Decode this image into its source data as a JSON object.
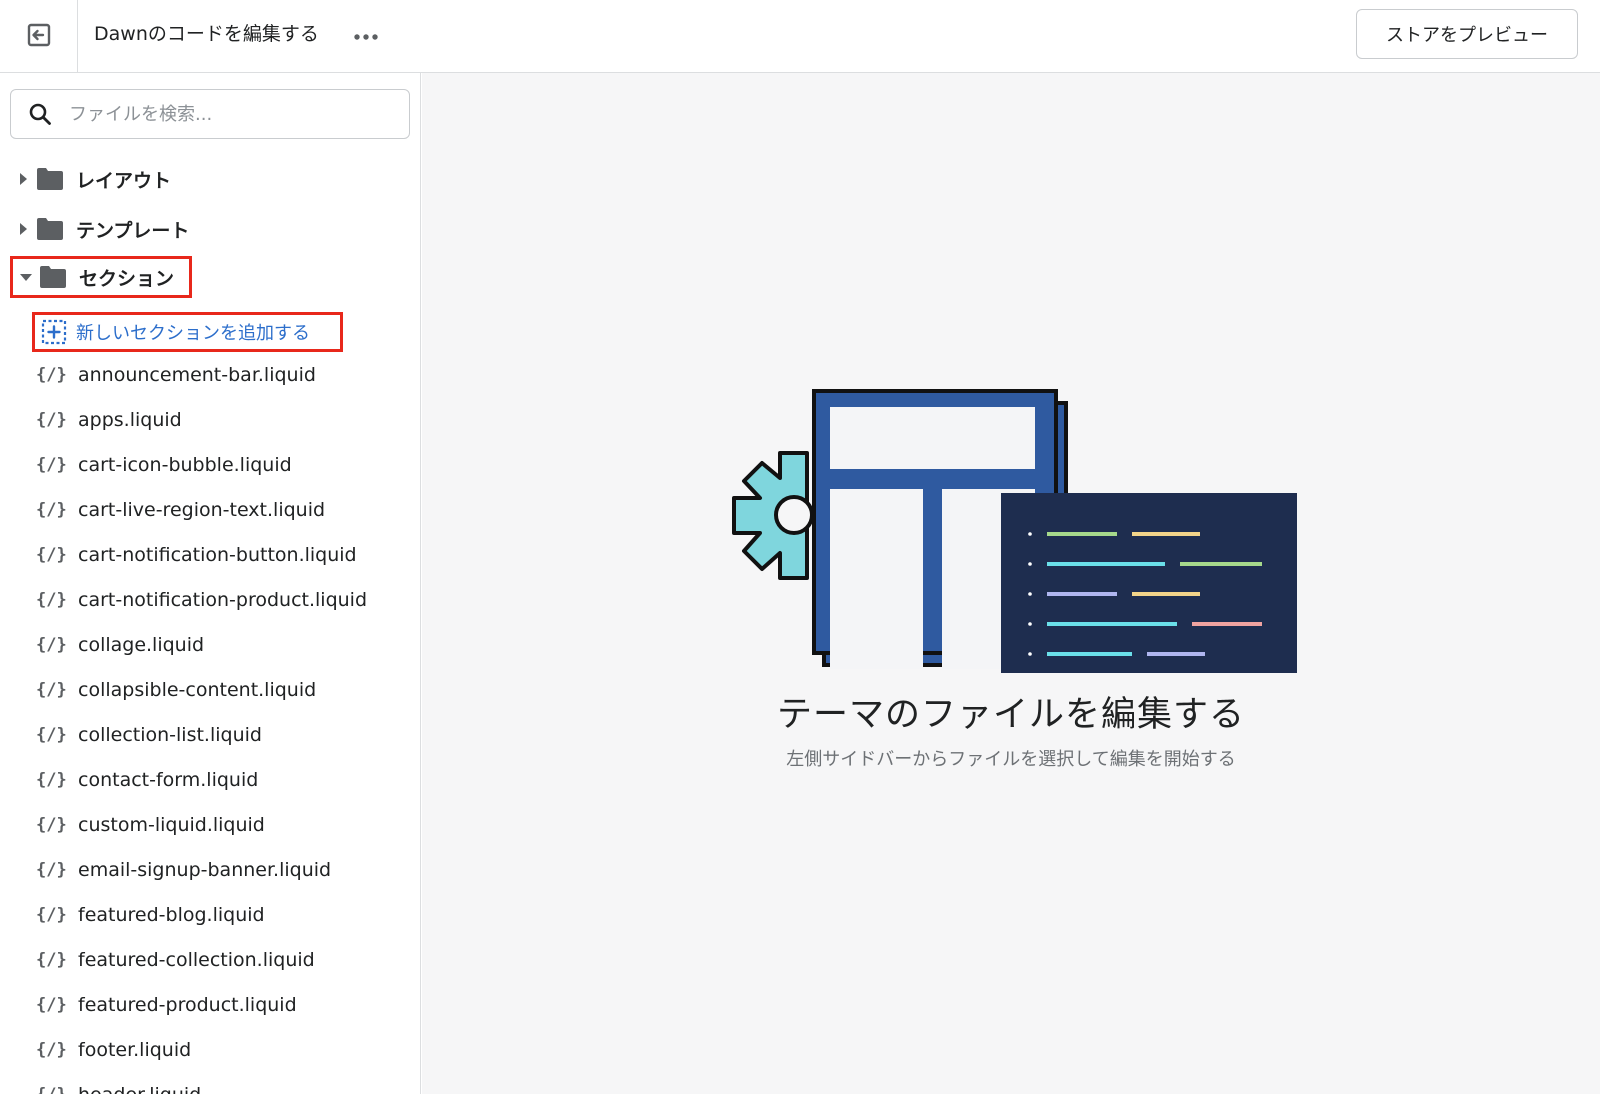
{
  "header": {
    "title": "Dawnのコードを編集する",
    "more_label": "•••",
    "preview_label": "ストアをプレビュー"
  },
  "sidebar": {
    "search": {
      "placeholder": "ファイルを検索..."
    },
    "folders": [
      {
        "label": "レイアウト",
        "expanded": false
      },
      {
        "label": "テンプレート",
        "expanded": false
      },
      {
        "label": "セクション",
        "expanded": true
      }
    ],
    "add_section_label": "新しいセクションを追加する",
    "liquid_icon": "{/}",
    "files": [
      "announcement-bar.liquid",
      "apps.liquid",
      "cart-icon-bubble.liquid",
      "cart-live-region-text.liquid",
      "cart-notification-button.liquid",
      "cart-notification-product.liquid",
      "collage.liquid",
      "collapsible-content.liquid",
      "collection-list.liquid",
      "contact-form.liquid",
      "custom-liquid.liquid",
      "email-signup-banner.liquid",
      "featured-blog.liquid",
      "featured-collection.liquid",
      "featured-product.liquid",
      "footer.liquid",
      "header.liquid"
    ]
  },
  "main": {
    "title": "テーマのファイルを編集する",
    "subtitle": "左側サイドバーからファイルを選択して編集を開始する"
  },
  "colors": {
    "highlight": "#e8281b",
    "link": "#2c6ecb",
    "illustration_blue": "#2f5aa0",
    "illustration_navy": "#1e2d4f",
    "illustration_gear": "#7fd6dd"
  }
}
